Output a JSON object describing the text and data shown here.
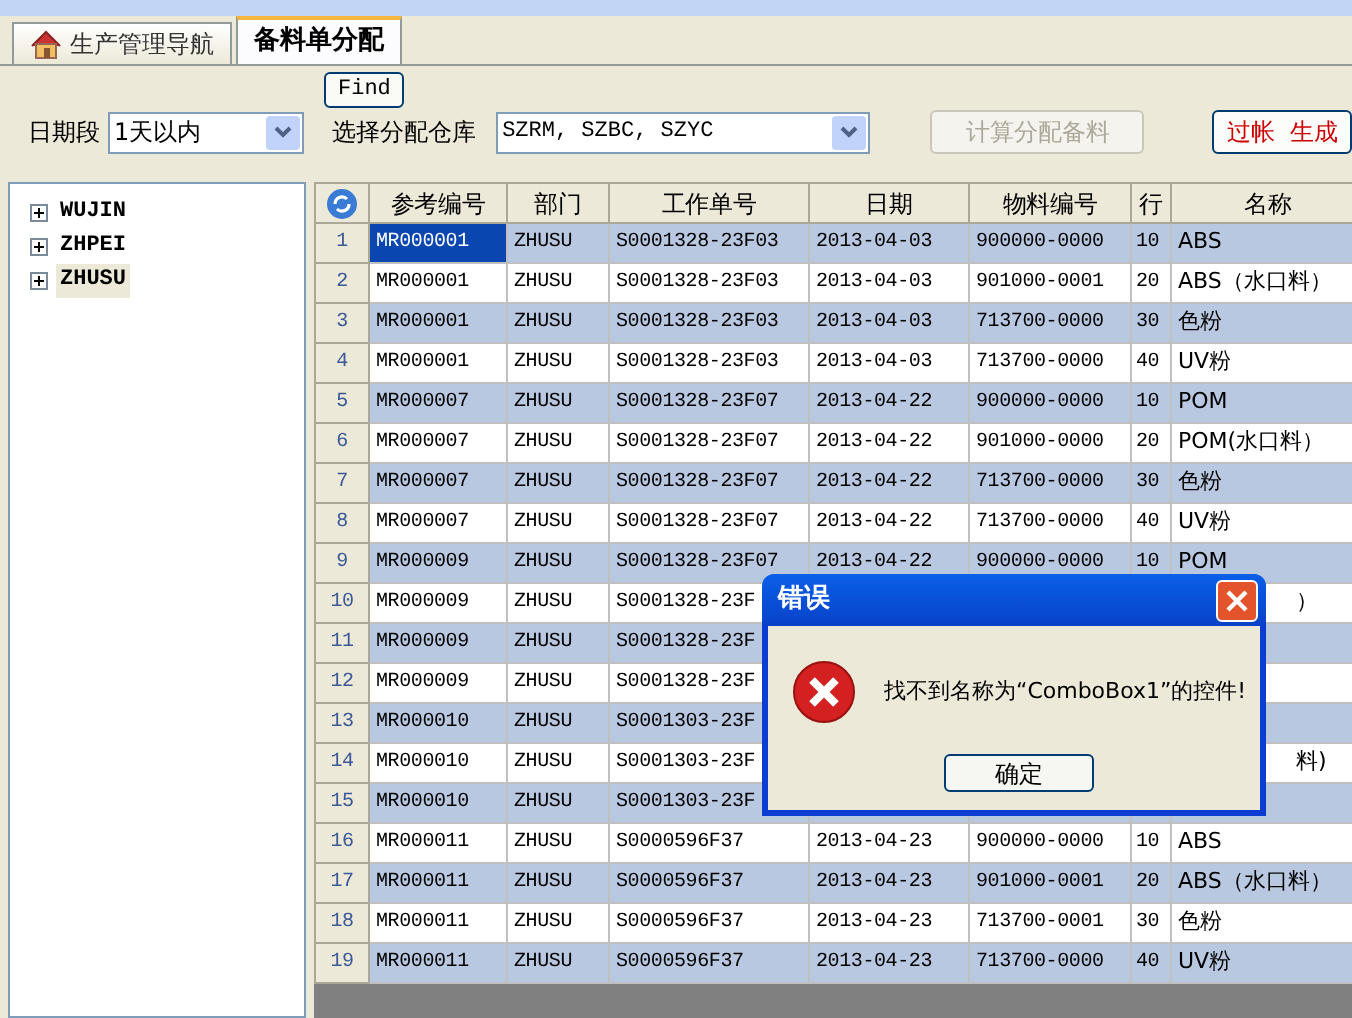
{
  "tabs": [
    {
      "label": "生产管理导航",
      "kind": "home",
      "selected": false
    },
    {
      "label": "备料单分配",
      "kind": "plain",
      "selected": true
    }
  ],
  "toolbar": {
    "find_button": "Find",
    "date_label": "日期段",
    "date_value": "1天以内",
    "warehouse_label": "选择分配仓库",
    "warehouse_value": "SZRM, SZBC, SZYC",
    "calc_button": {
      "label": "计算分配备料",
      "disabled": true
    },
    "post_button": {
      "label": "过帐  生成"
    }
  },
  "tree": [
    {
      "label": "WUJIN",
      "expanded": false,
      "selected": false
    },
    {
      "label": "ZHPEI",
      "expanded": false,
      "selected": false
    },
    {
      "label": "ZHUSU",
      "expanded": false,
      "selected": true
    }
  ],
  "table": {
    "columns": [
      "参考编号",
      "部门",
      "工作单号",
      "日期",
      "物料编号",
      "行",
      "名称"
    ],
    "rows": [
      {
        "n": "1",
        "ref": "MR000001",
        "dept": "ZHUSU",
        "job": "S0001328-23F03",
        "date": "2013-04-03",
        "material": "900000-0000",
        "line": "10",
        "name": "ABS",
        "selected": true
      },
      {
        "n": "2",
        "ref": "MR000001",
        "dept": "ZHUSU",
        "job": "S0001328-23F03",
        "date": "2013-04-03",
        "material": "901000-0001",
        "line": "20",
        "name": "ABS（水口料）",
        "selected": false
      },
      {
        "n": "3",
        "ref": "MR000001",
        "dept": "ZHUSU",
        "job": "S0001328-23F03",
        "date": "2013-04-03",
        "material": "713700-0000",
        "line": "30",
        "name": "色粉",
        "selected": false
      },
      {
        "n": "4",
        "ref": "MR000001",
        "dept": "ZHUSU",
        "job": "S0001328-23F03",
        "date": "2013-04-03",
        "material": "713700-0000",
        "line": "40",
        "name": "UV粉",
        "selected": false
      },
      {
        "n": "5",
        "ref": "MR000007",
        "dept": "ZHUSU",
        "job": "S0001328-23F07",
        "date": "2013-04-22",
        "material": "900000-0000",
        "line": "10",
        "name": "POM",
        "selected": false
      },
      {
        "n": "6",
        "ref": "MR000007",
        "dept": "ZHUSU",
        "job": "S0001328-23F07",
        "date": "2013-04-22",
        "material": "901000-0000",
        "line": "20",
        "name": "POM(水口料）",
        "selected": false
      },
      {
        "n": "7",
        "ref": "MR000007",
        "dept": "ZHUSU",
        "job": "S0001328-23F07",
        "date": "2013-04-22",
        "material": "713700-0000",
        "line": "30",
        "name": "色粉",
        "selected": false
      },
      {
        "n": "8",
        "ref": "MR000007",
        "dept": "ZHUSU",
        "job": "S0001328-23F07",
        "date": "2013-04-22",
        "material": "713700-0000",
        "line": "40",
        "name": "UV粉",
        "selected": false
      },
      {
        "n": "9",
        "ref": "MR000009",
        "dept": "ZHUSU",
        "job": "S0001328-23F07",
        "date": "2013-04-22",
        "material": "900000-0000",
        "line": "10",
        "name": "POM",
        "selected": false
      },
      {
        "n": "10",
        "ref": "MR000009",
        "dept": "ZHUSU",
        "job": "S0001328-23F",
        "name": "）",
        "selected": false
      },
      {
        "n": "11",
        "ref": "MR000009",
        "dept": "ZHUSU",
        "job": "S0001328-23F",
        "selected": false
      },
      {
        "n": "12",
        "ref": "MR000009",
        "dept": "ZHUSU",
        "job": "S0001328-23F",
        "selected": false
      },
      {
        "n": "13",
        "ref": "MR000010",
        "dept": "ZHUSU",
        "job": "S0001303-23F",
        "selected": false
      },
      {
        "n": "14",
        "ref": "MR000010",
        "dept": "ZHUSU",
        "job": "S0001303-23F",
        "name": "料)",
        "selected": false
      },
      {
        "n": "15",
        "ref": "MR000010",
        "dept": "ZHUSU",
        "job": "S0001303-23F",
        "selected": false
      },
      {
        "n": "16",
        "ref": "MR000011",
        "dept": "ZHUSU",
        "job": "S0000596F37",
        "date": "2013-04-23",
        "material": "900000-0000",
        "line": "10",
        "name": "ABS",
        "selected": false
      },
      {
        "n": "17",
        "ref": "MR000011",
        "dept": "ZHUSU",
        "job": "S0000596F37",
        "date": "2013-04-23",
        "material": "901000-0001",
        "line": "20",
        "name": "ABS（水口料）",
        "selected": false
      },
      {
        "n": "18",
        "ref": "MR000011",
        "dept": "ZHUSU",
        "job": "S0000596F37",
        "date": "2013-04-23",
        "material": "713700-0001",
        "line": "30",
        "name": "色粉",
        "selected": false
      },
      {
        "n": "19",
        "ref": "MR000011",
        "dept": "ZHUSU",
        "job": "S0000596F37",
        "date": "2013-04-23",
        "material": "713700-0000",
        "line": "40",
        "name": "UV粉",
        "selected": false
      }
    ]
  },
  "dialog": {
    "title": "错误",
    "message": "找不到名称为“ComboBox1”的控件!",
    "ok_button": "确定"
  }
}
